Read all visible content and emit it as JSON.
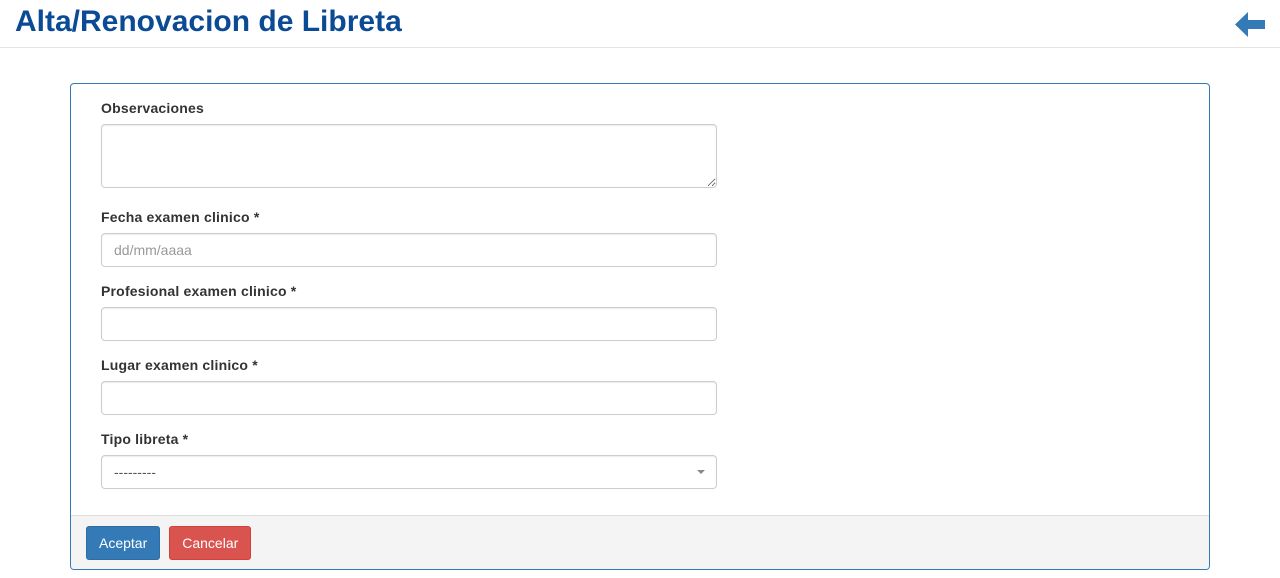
{
  "header": {
    "title": "Alta/Renovacion de Libreta",
    "back_icon": "arrow-left-icon",
    "accent": "#337ab7"
  },
  "form": {
    "observaciones": {
      "label": "Observaciones",
      "value": ""
    },
    "fecha": {
      "label": "Fecha examen clinico *",
      "placeholder": "dd/mm/aaaa",
      "value": ""
    },
    "profesional": {
      "label": "Profesional examen clinico *",
      "value": ""
    },
    "lugar": {
      "label": "Lugar examen clinico *",
      "value": ""
    },
    "tipo": {
      "label": "Tipo libreta *",
      "selected": "---------"
    }
  },
  "footer": {
    "accept": "Aceptar",
    "cancel": "Cancelar"
  }
}
